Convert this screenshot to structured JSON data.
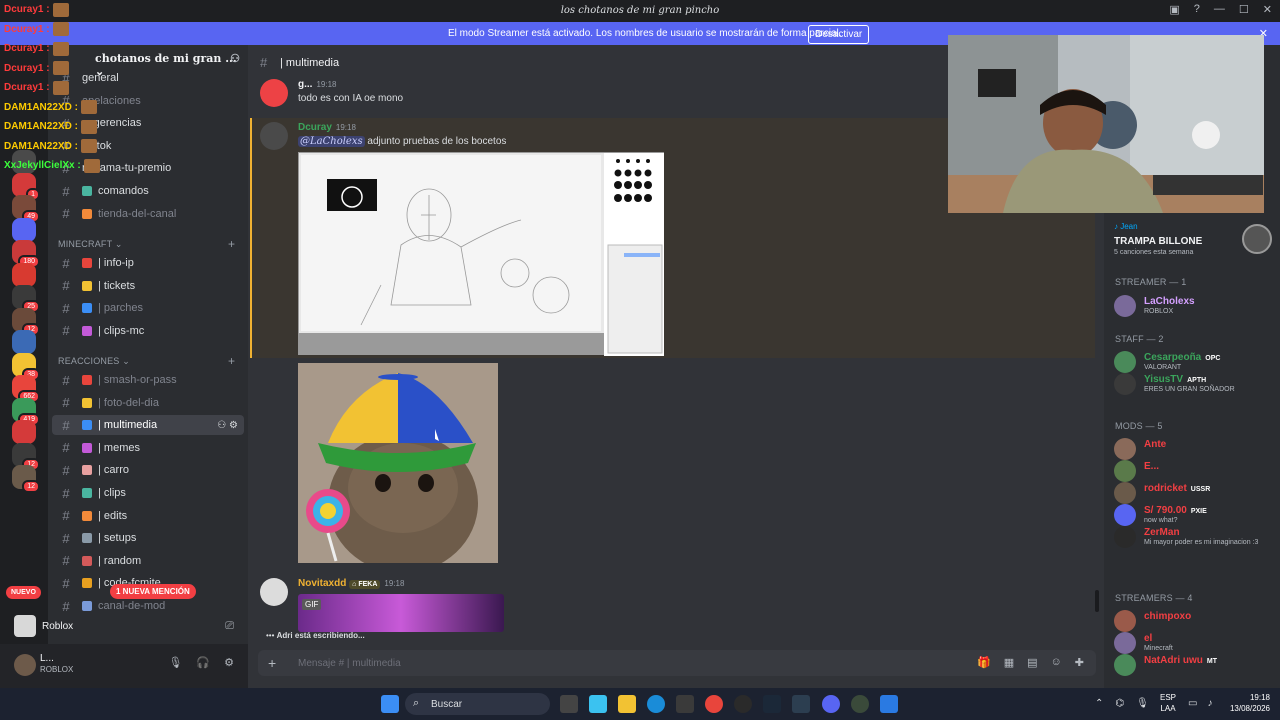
{
  "window": {
    "title": "los chotanos de mi gran pincho"
  },
  "streamer_banner": {
    "text": "El modo Streamer está activado. Los nombres de usuario se mostrarán de forma parcial.",
    "button": "Desactivar"
  },
  "stream_overlay_chat": [
    {
      "name": "Dcuray1 :",
      "color": "#ff3b3b"
    },
    {
      "name": "Dcuray1 :",
      "color": "#ff3b3b"
    },
    {
      "name": "Dcuray1 :",
      "color": "#ff3b3b"
    },
    {
      "name": "Dcuray1 :",
      "color": "#ff3b3b"
    },
    {
      "name": "Dcuray1 :",
      "color": "#ff3b3b"
    },
    {
      "name": "DAM1AN22XD :",
      "color": "#ffcc00"
    },
    {
      "name": "DAM1AN22XD :",
      "color": "#ffcc00"
    },
    {
      "name": "DAM1AN22XD :",
      "color": "#ffcc00"
    },
    {
      "name": "XxJekyllCielXx :",
      "color": "#3cff3c"
    }
  ],
  "server": {
    "name": "chotanos de mi gran ..."
  },
  "server_badges": [
    "",
    "1",
    "49",
    "",
    "180",
    "",
    "25",
    "12",
    "",
    "38",
    "662",
    "419",
    "",
    "12",
    "12"
  ],
  "categories": {
    "minecraft": "MINECRAFT",
    "reacciones": "REACCIONES"
  },
  "channels_top": [
    {
      "label": "general",
      "muted": false
    },
    {
      "label": "apelaciones",
      "muted": true
    },
    {
      "label": "sugerencias",
      "muted": false
    },
    {
      "label": "tik-tok",
      "muted": false
    },
    {
      "label": "reclama-tu-premio",
      "muted": false
    },
    {
      "label": "comandos",
      "muted": false
    },
    {
      "label": "tienda-del-canal",
      "muted": true
    }
  ],
  "channels_minecraft": [
    {
      "label": "| info-ip",
      "muted": false
    },
    {
      "label": "| tickets",
      "muted": false
    },
    {
      "label": "| parches",
      "muted": true
    },
    {
      "label": "| clips-mc",
      "muted": false
    }
  ],
  "channels_reacciones": [
    {
      "label": "| smash-or-pass",
      "muted": true
    },
    {
      "label": "| foto-del-dia",
      "muted": true
    },
    {
      "label": "| multimedia",
      "muted": false,
      "active": true
    },
    {
      "label": "| memes",
      "muted": false
    },
    {
      "label": "| carro",
      "muted": false
    },
    {
      "label": "| clips",
      "muted": false
    },
    {
      "label": "| edits",
      "muted": false
    },
    {
      "label": "| setups",
      "muted": false
    },
    {
      "label": "| random",
      "muted": false
    },
    {
      "label": "| code-fcmite",
      "muted": false
    },
    {
      "label": "canal-de-mod",
      "muted": true
    }
  ],
  "pills": {
    "new": "NUEVO",
    "mention": "1 NUEVA MENCIÓN"
  },
  "activity": {
    "game": "Roblox"
  },
  "user": {
    "name": "L...",
    "status": "ROBLOX"
  },
  "chat": {
    "channel": "| multimedia",
    "messages": [
      {
        "author": "g...",
        "time": "19:18",
        "text": "todo es con IA oe mono",
        "color": "#f2f3f5"
      },
      {
        "author": "Dcuray",
        "time": "19:18",
        "mention": "@LaCholexs",
        "text": "adjunto pruebas de los bocetos",
        "color": "#3ba55c"
      },
      {
        "author": "Novitaxdd",
        "tag": "FEKA",
        "time": "19:18",
        "color": "#f0b232"
      }
    ],
    "gif_label": "GIF",
    "typing": "Adri está escribiendo...",
    "placeholder": "Mensaje # | multimedia"
  },
  "now_playing": {
    "user": "Jean",
    "song": "TRAMPA BILLONE",
    "sub": "5 canciones esta semana"
  },
  "member_groups": {
    "streamer": "STREAMER — 1",
    "staff": "STAFF — 2",
    "mods": "MODS — 5",
    "streamers": "STREAMERS — 4"
  },
  "members_streamer": [
    {
      "name": "LaCholexs",
      "status": "ROBLOX",
      "color": "#d4a0ff"
    }
  ],
  "members_staff": [
    {
      "name": "Cesarpeoña",
      "tag": "OPC",
      "status": "VALORANT",
      "color": "#3ba55c"
    },
    {
      "name": "YisusTV",
      "tag": "APTH",
      "status": "ERES UN GRAN SOÑADOR",
      "color": "#3ba55c"
    }
  ],
  "members_mods": [
    {
      "name": "Ante",
      "tag": "",
      "status": "",
      "color": "#f23f43"
    },
    {
      "name": "E...",
      "tag": "",
      "status": "",
      "color": "#f23f43"
    },
    {
      "name": "rodricket",
      "tag": "USSR",
      "status": "",
      "color": "#f23f43"
    },
    {
      "name": "S/ 790.00",
      "tag": "PXIE",
      "status": "now what?",
      "color": "#f23f43"
    },
    {
      "name": "ZerMan",
      "tag": "",
      "status": "Mi mayor poder es mi imaginacion :3",
      "color": "#f23f43"
    }
  ],
  "members_streamers": [
    {
      "name": "chimpoxo",
      "tag": "",
      "status": "",
      "color": "#f23f43"
    },
    {
      "name": "el",
      "tag": "",
      "status": "Minecraft",
      "color": "#f23f43"
    },
    {
      "name": "NatAdri uwu",
      "tag": "MT",
      "status": "",
      "color": "#f23f43"
    }
  ],
  "taskbar": {
    "search": "Buscar",
    "lang": "ESP",
    "lang2": "LAA",
    "time": "19:18",
    "date": "13/08/2026"
  }
}
